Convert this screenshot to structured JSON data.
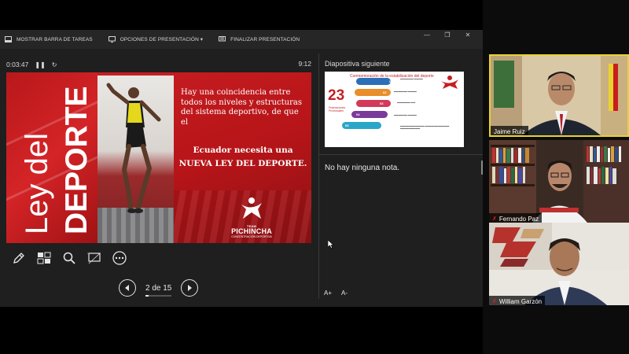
{
  "toolbar": {
    "taskbar_label": "MOSTRAR BARRA DE TAREAS",
    "options_label": "OPCIONES DE PRESENTACIÓN ▾",
    "end_label": "FINALIZAR PRESENTACIÓN",
    "minimize": "—",
    "restore": "❐",
    "close": "✕"
  },
  "timer": {
    "elapsed": "0:03:47",
    "pause_icon": "pause-icon",
    "reset_icon": "reset-icon",
    "clock": "9:12"
  },
  "current_slide": {
    "title_line1": "Ley del",
    "title_line2": "DEPORTE",
    "body": "Hay una coincidencia entre todos los niveles y estructuras del sistema deportivo, de que el",
    "body_bold": "Ecuador necesita una NUEVA LEY DEL DEPORTE.",
    "logo_team": "TEAM",
    "logo_name": "PICHINCHA",
    "logo_sub": "CONCENTRACIÓN DEPORTIVA"
  },
  "tools": [
    {
      "name": "pen-tool",
      "icon": "pen-icon"
    },
    {
      "name": "see-all-slides",
      "icon": "grid-icon"
    },
    {
      "name": "zoom-slide",
      "icon": "magnifier-icon"
    },
    {
      "name": "black-screen",
      "icon": "screen-icon"
    },
    {
      "name": "more-options",
      "icon": "ellipsis-icon"
    }
  ],
  "navigation": {
    "counter": "2 de 15",
    "progress": 0.13
  },
  "next_slide": {
    "label": "Diapositiva siguiente",
    "title": "Conmemoración de la estabilización del deporte",
    "big_number": "23",
    "caption": "Federaciones Provinciales",
    "steps": [
      "01",
      "02",
      "03",
      "04",
      "05"
    ]
  },
  "notes": {
    "text": "No hay ninguna nota."
  },
  "font_controls": {
    "increase": "A+",
    "decrease": "A-"
  },
  "participants": [
    {
      "name": "Jaime Ruiz",
      "active": true
    },
    {
      "name": "Fernando Paz",
      "active": false
    },
    {
      "name": "William Garzón",
      "active": false
    }
  ]
}
